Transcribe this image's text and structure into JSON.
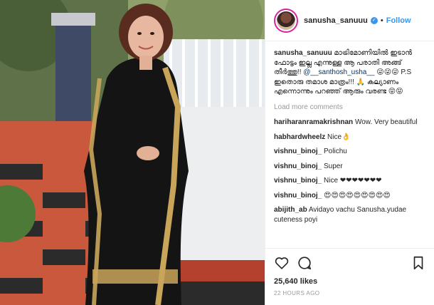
{
  "header": {
    "username": "sanusha_sanuuu",
    "follow_label": "Follow",
    "separator": "•"
  },
  "caption": {
    "username": "sanusha_sanuuu",
    "text": "മാട്രിമോണിയിൽ ഇടാൻ ഫോട്ടം ഇല്ല എന്നുള്ള ആ പരാതി അങ്ങ് തീർത്തു!! ",
    "mention": "@__santhosh_usha__",
    "text2": " 😜😜😜 P.S ഇതൊരു തമാശ മാത്രം!!! 🙏 കല്യാണം എന്നൊന്നും പറഞ്ഞ് ആരും വരണ്ട 😝😝"
  },
  "load_more_label": "Load more comments",
  "comments": [
    {
      "user": "hariharanramakrishnan",
      "text": "Wow. Very beautiful"
    },
    {
      "user": "habhardwheelz",
      "text": "Nice👌"
    },
    {
      "user": "vishnu_binoj_",
      "text": "Polichu"
    },
    {
      "user": "vishnu_binoj_",
      "text": "Super"
    },
    {
      "user": "vishnu_binoj_",
      "text": "Nice ❤❤❤❤❤❤❤"
    },
    {
      "user": "vishnu_binoj_",
      "text": "😍😍😍😍😍😍😍😍😍"
    },
    {
      "user": "abijith_ab",
      "text": "Avidayo vachu Sanusha.yudae cuteness poyi"
    }
  ],
  "likes": "25,640 likes",
  "timestamp": "22 HOURS AGO",
  "colors": {
    "link": "#3897f0",
    "avatar_ring": "#d6249f",
    "muted": "#999999"
  },
  "icons": [
    "heart-icon",
    "comment-icon",
    "bookmark-icon",
    "verified-badge-icon"
  ]
}
